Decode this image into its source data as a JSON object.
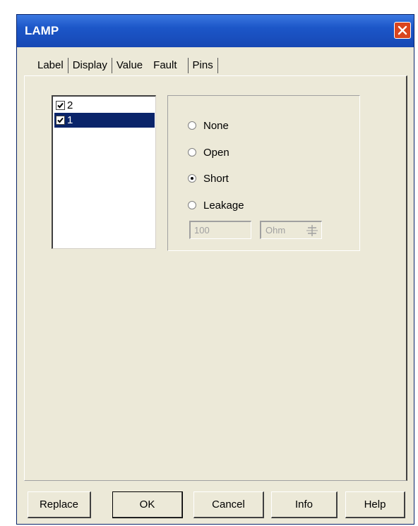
{
  "window": {
    "title": "LAMP"
  },
  "tabs": [
    "Label",
    "Display",
    "Value",
    "Fault",
    "Pins"
  ],
  "active_tab": "Fault",
  "pin_list": [
    {
      "label": "2",
      "checked": true,
      "selected": false
    },
    {
      "label": "1",
      "checked": true,
      "selected": true
    }
  ],
  "fault_options": [
    {
      "label": "None",
      "checked": false
    },
    {
      "label": "Open",
      "checked": false
    },
    {
      "label": "Short",
      "checked": true
    },
    {
      "label": "Leakage",
      "checked": false
    }
  ],
  "leakage": {
    "value": "100",
    "unit": "Ohm"
  },
  "buttons": {
    "replace": "Replace",
    "ok": "OK",
    "cancel": "Cancel",
    "info": "Info",
    "help": "Help"
  },
  "icons": {
    "close": "close-icon",
    "spin": "spin-arrows-icon",
    "check": "checkmark-icon"
  },
  "colors": {
    "titlebar": "#1c56c8",
    "selection": "#0a246a",
    "close": "#d9451e",
    "dialog": "#ece9d8"
  }
}
